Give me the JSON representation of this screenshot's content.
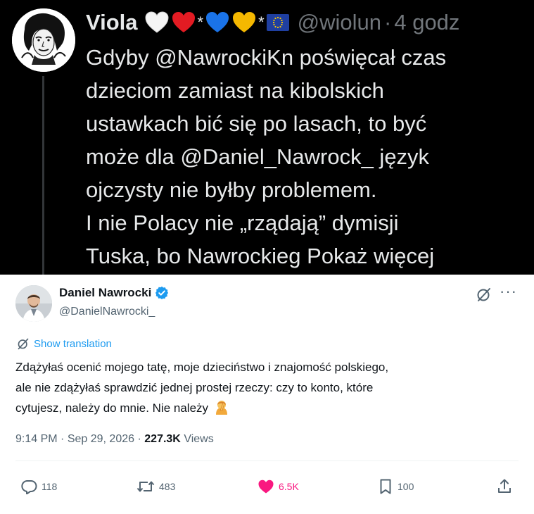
{
  "quoted": {
    "author_name": "Viola",
    "emoji": [
      "white-heart",
      "red-heart",
      "star-superscript",
      "blue-heart",
      "yellow-heart",
      "star-superscript",
      "eu-flag"
    ],
    "handle": "@wiolun",
    "separator": "·",
    "time": "4 godz",
    "text_lines": [
      "Gdyby @NawrockiKn poświęcał czas",
      "dzieciom zamiast na kibolskich",
      "ustawkach bić się po lasach, to być",
      "może dla @Daniel_Nawrock_ język",
      "ojczysty nie byłby problemem.",
      "I nie Polacy nie „rządają” dymisji",
      "Tuska, bo Nawrockieg"
    ],
    "show_more": "Pokaż więcej",
    "colors": {
      "background": "#000000",
      "text": "#e7e9ea",
      "muted": "#71767b"
    }
  },
  "reply": {
    "author_name": "Daniel Nawrocki",
    "verified_icon": "verified-badge-icon",
    "handle": "@DanielNawrocki_",
    "show_translation": "Show translation",
    "text_lines": [
      "Zdążyłaś ocenić mojego tatę, moje dzieciństwo i znajomość polskiego,",
      "ale nie zdążyłaś sprawdzić jednej prostej rzeczy: czy to konto, które",
      "cytujesz, należy do mnie. Nie należy"
    ],
    "trailing_emoji": "person-facepalming",
    "time": "9:14 PM",
    "meta_separator": "·",
    "date": "Sep 29, 2026",
    "views_count": "227.3K",
    "views_label": "Views",
    "actions": {
      "reply_count": "118",
      "retweet_count": "483",
      "like_count": "6.5K",
      "bookmark_count": "100"
    },
    "colors": {
      "accent": "#1d9bf0",
      "like": "#f91880",
      "muted": "#536471",
      "text": "#0f1419"
    }
  }
}
